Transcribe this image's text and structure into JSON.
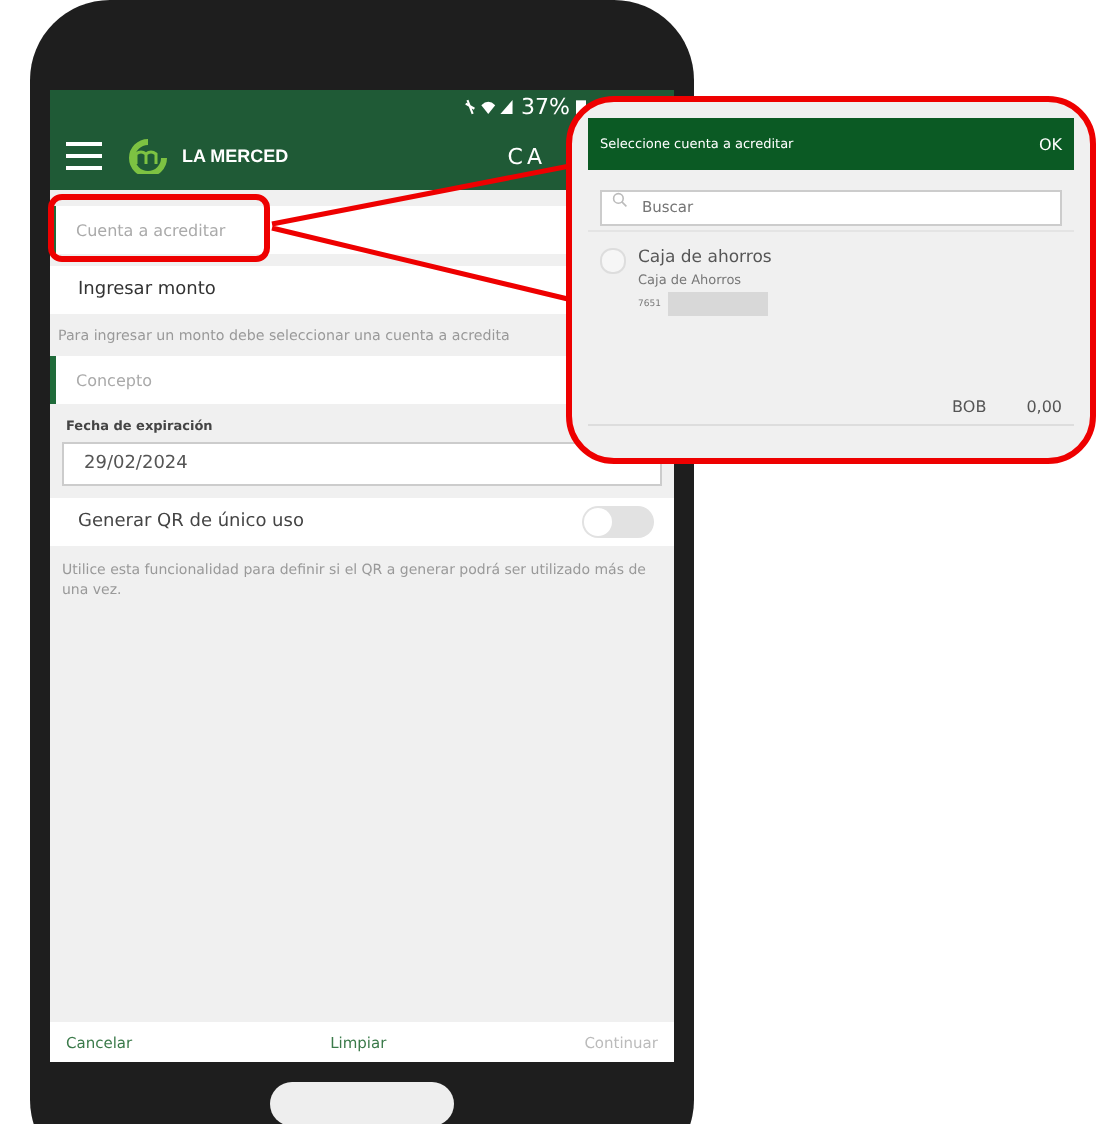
{
  "status_bar": {
    "battery": "37%"
  },
  "header": {
    "logo_text": "LA MERCED",
    "action_partial": "CA"
  },
  "form": {
    "account_field": {
      "placeholder": "Cuenta a acreditar",
      "highlighted": true
    },
    "amount_row": {
      "label": "Ingresar monto"
    },
    "amount_hint": "Para ingresar un monto debe seleccionar una cuenta a acredita",
    "concept_field": {
      "placeholder": "Concepto"
    },
    "expiry_label": "Fecha de expiración",
    "expiry_field": {
      "value": "29/02/2024"
    },
    "single_use": {
      "label": "Generar QR de único uso",
      "on": false
    },
    "single_use_help": "Utilice esta funcionalidad para definir si el QR a generar podrá ser utilizado más de una vez."
  },
  "footer": {
    "buttons": [
      {
        "label": "Cancelar",
        "disabled": false
      },
      {
        "label": "Limpiar",
        "disabled": false
      },
      {
        "label": "Continuar",
        "disabled": true
      }
    ]
  },
  "popup": {
    "title": "Seleccione cuenta a acreditar",
    "ok": "OK",
    "search": {
      "placeholder": "Buscar"
    },
    "accounts": [
      {
        "name": "Caja de ahorros",
        "type": "Caja de Ahorros",
        "number": "7651",
        "selected": false
      }
    ],
    "balance": {
      "currency": "BOB",
      "amount": "0,00"
    }
  }
}
